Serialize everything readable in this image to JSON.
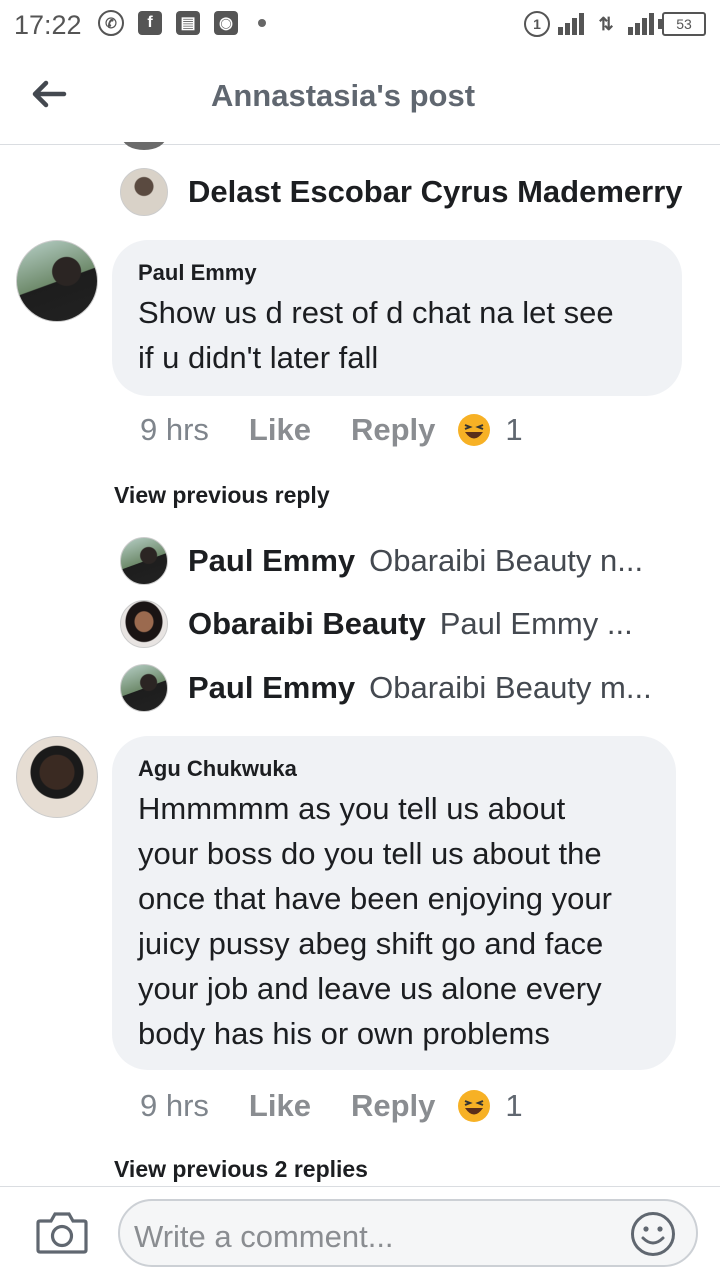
{
  "status_bar": {
    "time": "17:22",
    "battery": "53"
  },
  "header": {
    "title": "Annastasia's post"
  },
  "top_reply": {
    "name": "Delast Escobar Cyrus Mademerry"
  },
  "comments": [
    {
      "author": "Paul Emmy",
      "text": "Show us d rest of d chat na let see\nif u didn't later fall",
      "time": "9 hrs",
      "like": "Like",
      "reply": "Reply",
      "reaction_count": "1",
      "view_previous": "View previous reply"
    },
    {
      "author": "Agu Chukwuka",
      "text": "Hmmmmm as you tell us about\nyour boss do you tell us about the\nonce that have been enjoying your\njuicy pussy abeg shift go and face\nyour job and leave us alone every\nbody has his or own problems",
      "time": "9 hrs",
      "like": "Like",
      "reply": "Reply",
      "reaction_count": "1",
      "view_previous": "View previous 2 replies"
    }
  ],
  "replies": [
    {
      "name": "Paul Emmy",
      "preview": "Obaraibi Beauty n..."
    },
    {
      "name": "Obaraibi Beauty",
      "preview": "Paul Emmy ..."
    },
    {
      "name": "Paul Emmy",
      "preview": "Obaraibi Beauty m..."
    }
  ],
  "composer": {
    "placeholder": "Write a comment..."
  },
  "colors": {
    "bubble": "#f0f2f5",
    "reaction": "#f7b125"
  },
  "icons": [
    "back-arrow-icon",
    "camera-icon",
    "emoji-icon",
    "laughing-emoji-icon"
  ]
}
